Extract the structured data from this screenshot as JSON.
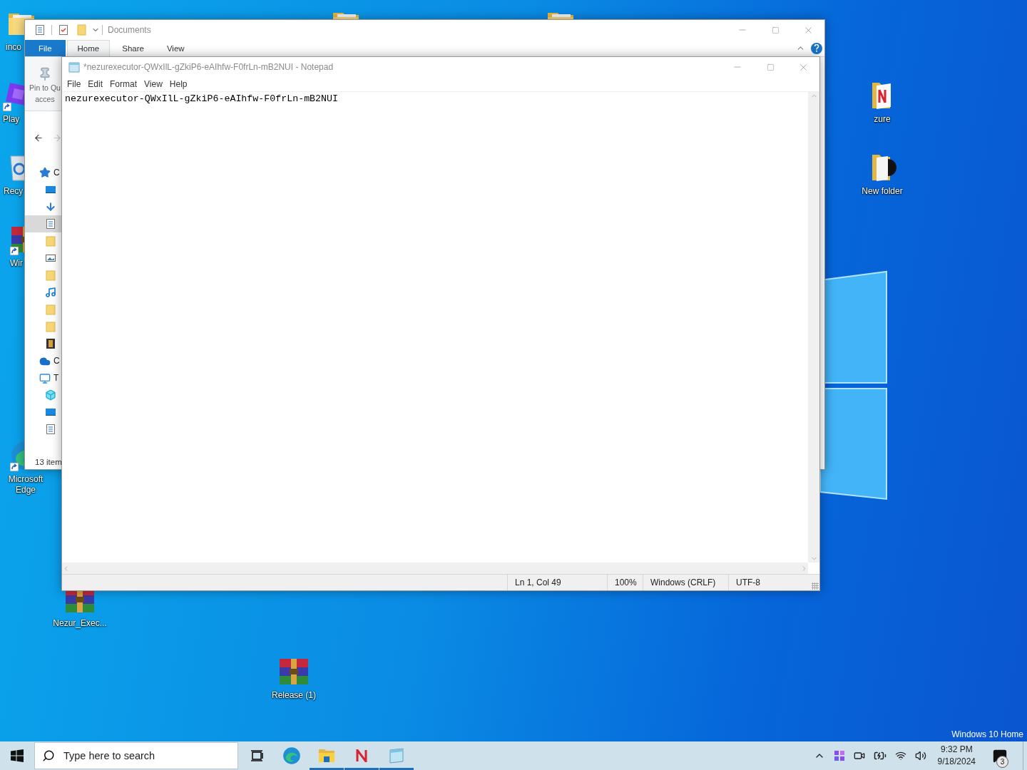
{
  "desktop": {
    "icons": [
      {
        "kind": "folder",
        "label": "inco",
        "shortcut": false
      },
      {
        "kind": "app",
        "label": "Play",
        "shortcut": true
      },
      {
        "kind": "recycle-bin",
        "label": "Recy",
        "shortcut": false
      },
      {
        "kind": "archive",
        "label": "Wir",
        "shortcut": true
      },
      {
        "kind": "edge",
        "label": "Microsoft Edge",
        "shortcut": true
      },
      {
        "kind": "archive",
        "label": "Nezur_Exec...",
        "shortcut": false
      },
      {
        "kind": "archive",
        "label": "Release (1)",
        "shortcut": false
      },
      {
        "kind": "folder-n",
        "label": "zure",
        "shortcut": false
      },
      {
        "kind": "folder-disc",
        "label": "New folder",
        "shortcut": false
      },
      {
        "kind": "folder"
      },
      {
        "kind": "folder"
      }
    ],
    "edition": "Windows 10 Home"
  },
  "explorer": {
    "title": "Documents",
    "tabs": [
      {
        "label": "File",
        "kind": "file"
      },
      {
        "label": "Home",
        "selected": true,
        "kind": "tab"
      },
      {
        "label": "Share",
        "selected": false,
        "kind": "tab"
      },
      {
        "label": "View",
        "selected": false,
        "kind": "tab"
      }
    ],
    "pin_button": {
      "line_1": "Pin to Qu",
      "line_2": "acces"
    },
    "nav": [
      {
        "kind": "quick-access",
        "label": "C",
        "selected": false,
        "children": [
          {
            "kind": "desktop",
            "selected": false
          },
          {
            "kind": "download",
            "selected": false
          },
          {
            "kind": "document",
            "selected": true
          },
          {
            "kind": "folder",
            "selected": false
          },
          {
            "kind": "picture",
            "selected": false
          },
          {
            "kind": "folder",
            "selected": false
          },
          {
            "kind": "music",
            "selected": false
          },
          {
            "kind": "folder",
            "selected": false
          },
          {
            "kind": "folder",
            "selected": false
          },
          {
            "kind": "video",
            "selected": false
          }
        ]
      },
      {
        "kind": "onedrive",
        "label": "C",
        "selected": false
      },
      {
        "kind": "this-pc",
        "label": "T",
        "selected": false,
        "children": [
          {
            "kind": "cube",
            "selected": false
          },
          {
            "kind": "desktop",
            "selected": false
          },
          {
            "kind": "document",
            "selected": false
          }
        ]
      }
    ],
    "status": "13 item"
  },
  "notepad": {
    "title": "*nezurexecutor-QWxIlL-gZkiP6-eAIhfw-F0frLn-mB2NUI - Notepad",
    "menu": [
      "File",
      "Edit",
      "Format",
      "View",
      "Help"
    ],
    "content": "nezurexecutor-QWxIlL-gZkiP6-eAIhfw-F0frLn-mB2NUI",
    "status": [
      "Ln 1, Col 49",
      "100%",
      "Windows (CRLF)",
      "UTF-8"
    ]
  },
  "taskbar": {
    "search_placeholder": "Type here to search",
    "apps": [
      {
        "kind": "task-view",
        "active": false
      },
      {
        "kind": "edge",
        "active": false
      },
      {
        "kind": "explorer",
        "active": true
      },
      {
        "kind": "n-app",
        "active": true
      },
      {
        "kind": "notepad",
        "active": true
      }
    ],
    "time": "9:32 PM",
    "date": "9/18/2024",
    "notifications": "3"
  }
}
